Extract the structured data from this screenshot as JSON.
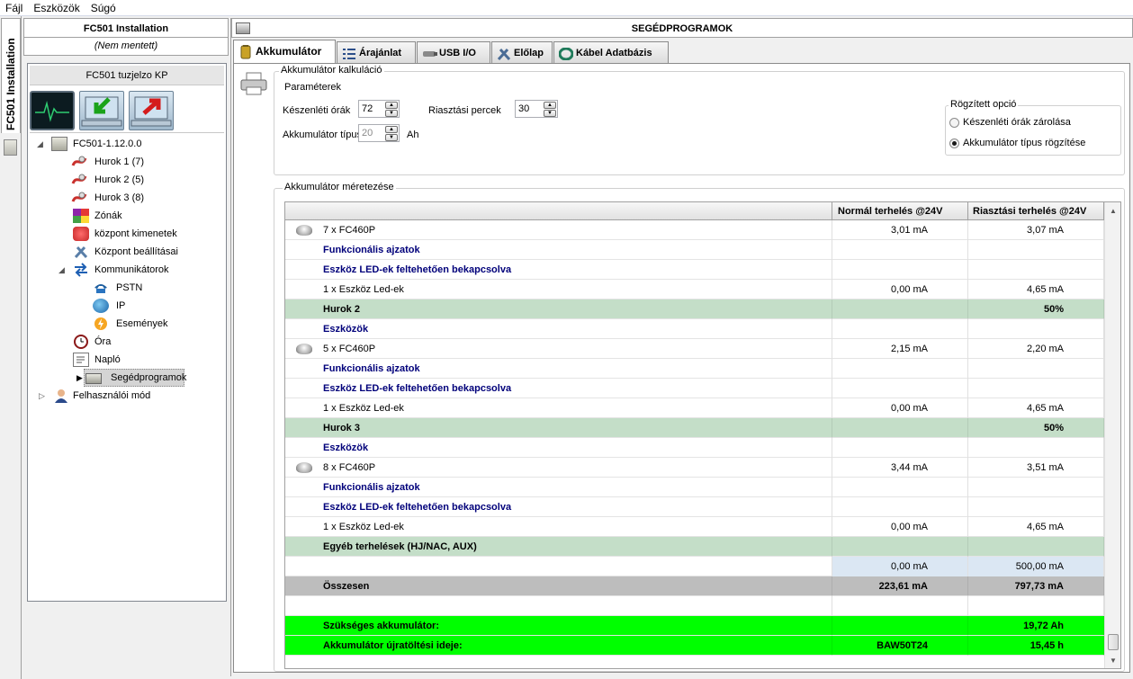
{
  "menu": [
    "Fájl",
    "Eszközök",
    "Súgó"
  ],
  "vertical_tab": {
    "label": "FC501 Installation"
  },
  "left_panel": {
    "title": "FC501 Installation",
    "subtitle": "(Nem mentett)",
    "box_title": "FC501 tuzjelzo KP",
    "tree": [
      {
        "label": "FC501-1.12.0.0",
        "icon": "panel-icon"
      },
      {
        "label": "Hurok 1 (7)",
        "icon": "loop-icon"
      },
      {
        "label": "Hurok 2 (5)",
        "icon": "loop-icon"
      },
      {
        "label": "Hurok 3 (8)",
        "icon": "loop-icon"
      },
      {
        "label": "Zónák",
        "icon": "zones-icon"
      },
      {
        "label": "központ kimenetek",
        "icon": "outputs-icon"
      },
      {
        "label": "Központ beállításai",
        "icon": "settings-icon"
      },
      {
        "label": "Kommunikátorok",
        "icon": "communicator-icon"
      },
      {
        "label": "PSTN",
        "icon": "phone-icon"
      },
      {
        "label": "IP",
        "icon": "globe-icon"
      },
      {
        "label": "Események",
        "icon": "events-icon"
      },
      {
        "label": "Óra",
        "icon": "clock-icon"
      },
      {
        "label": "Napló",
        "icon": "log-icon"
      },
      {
        "label": "Segédprogramok",
        "icon": "toolbox-icon"
      },
      {
        "label": "Felhasználói mód",
        "icon": "user-icon"
      }
    ]
  },
  "right_panel": {
    "title": "SEGÉDPROGRAMOK",
    "tabs": [
      {
        "label": "Akkumulátor",
        "icon": "battery-icon",
        "active": true
      },
      {
        "label": "Árajánlat",
        "icon": "list-icon",
        "active": false
      },
      {
        "label": "USB I/O",
        "icon": "usb-icon",
        "active": false
      },
      {
        "label": "Előlap",
        "icon": "tools-icon",
        "active": false
      },
      {
        "label": "Kábel Adatbázis",
        "icon": "cable-icon",
        "active": false
      }
    ]
  },
  "calc": {
    "group_title": "Akkumulátor kalkuláció",
    "params_title": "Paraméterek",
    "standby_label": "Készenléti órák",
    "standby_value": "72",
    "alarm_label": "Riasztási percek",
    "alarm_value": "30",
    "battery_type_label": "Akkumulátor típus",
    "battery_type_value": "20",
    "battery_unit": "Ah",
    "fixed_title": "Rögzített opció",
    "fixed_option_1": "Készenléti órák zárolása",
    "fixed_option_2": "Akkumulátor típus rögzítése",
    "fixed_selected": 2
  },
  "sizing": {
    "title": "Akkumulátor méretezése",
    "headers": [
      "",
      "Normál terhelés @24V",
      "Riasztási terhelés @24V"
    ],
    "rows": [
      {
        "type": "device",
        "label": "7 x FC460P",
        "normal": "3,01 mA",
        "alarm": "3,07 mA"
      },
      {
        "type": "section",
        "label": "Funkcionális ajzatok",
        "normal": "",
        "alarm": ""
      },
      {
        "type": "section",
        "label": "Eszköz LED-ek feltehetően bekapcsolva",
        "normal": "",
        "alarm": ""
      },
      {
        "type": "plain",
        "label": "1 x Eszköz Led-ek",
        "normal": "0,00 mA",
        "alarm": "4,65 mA"
      },
      {
        "type": "loop",
        "label": "Hurok 2",
        "normal": "",
        "alarm": "50%"
      },
      {
        "type": "section",
        "label": "Eszközök",
        "normal": "",
        "alarm": ""
      },
      {
        "type": "device",
        "label": "5 x FC460P",
        "normal": "2,15 mA",
        "alarm": "2,20 mA"
      },
      {
        "type": "section",
        "label": "Funkcionális ajzatok",
        "normal": "",
        "alarm": ""
      },
      {
        "type": "section",
        "label": "Eszköz LED-ek feltehetően bekapcsolva",
        "normal": "",
        "alarm": ""
      },
      {
        "type": "plain",
        "label": "1 x Eszköz Led-ek",
        "normal": "0,00 mA",
        "alarm": "4,65 mA"
      },
      {
        "type": "loop",
        "label": "Hurok 3",
        "normal": "",
        "alarm": "50%"
      },
      {
        "type": "section",
        "label": "Eszközök",
        "normal": "",
        "alarm": ""
      },
      {
        "type": "device",
        "label": "8 x FC460P",
        "normal": "3,44 mA",
        "alarm": "3,51 mA"
      },
      {
        "type": "section",
        "label": "Funkcionális ajzatok",
        "normal": "",
        "alarm": ""
      },
      {
        "type": "section",
        "label": "Eszköz LED-ek feltehetően bekapcsolva",
        "normal": "",
        "alarm": ""
      },
      {
        "type": "plain",
        "label": "1 x Eszköz Led-ek",
        "normal": "0,00 mA",
        "alarm": "4,65 mA"
      },
      {
        "type": "loop",
        "label": "Egyéb terhelések (HJ/NAC, AUX)",
        "normal": "",
        "alarm": ""
      },
      {
        "type": "other",
        "label": "",
        "normal": "0,00 mA",
        "alarm": "500,00 mA"
      },
      {
        "type": "total",
        "label": "Összesen",
        "normal": "223,61 mA",
        "alarm": "797,73 mA"
      },
      {
        "type": "blank",
        "label": "",
        "normal": "",
        "alarm": ""
      },
      {
        "type": "result",
        "label": "Szükséges akkumulátor:",
        "normal": "",
        "alarm": "19,72 Ah"
      },
      {
        "type": "result",
        "label": "Akkumulátor újratöltési ideje:",
        "normal": "BAW50T24",
        "alarm": "15,45 h"
      }
    ]
  },
  "colors": {
    "section_text": "#00007a",
    "loop_row": "#c4dec8",
    "total_row": "#bdbdbd",
    "result_row": "#00ff00",
    "other_cell": "#dbe7f3"
  }
}
